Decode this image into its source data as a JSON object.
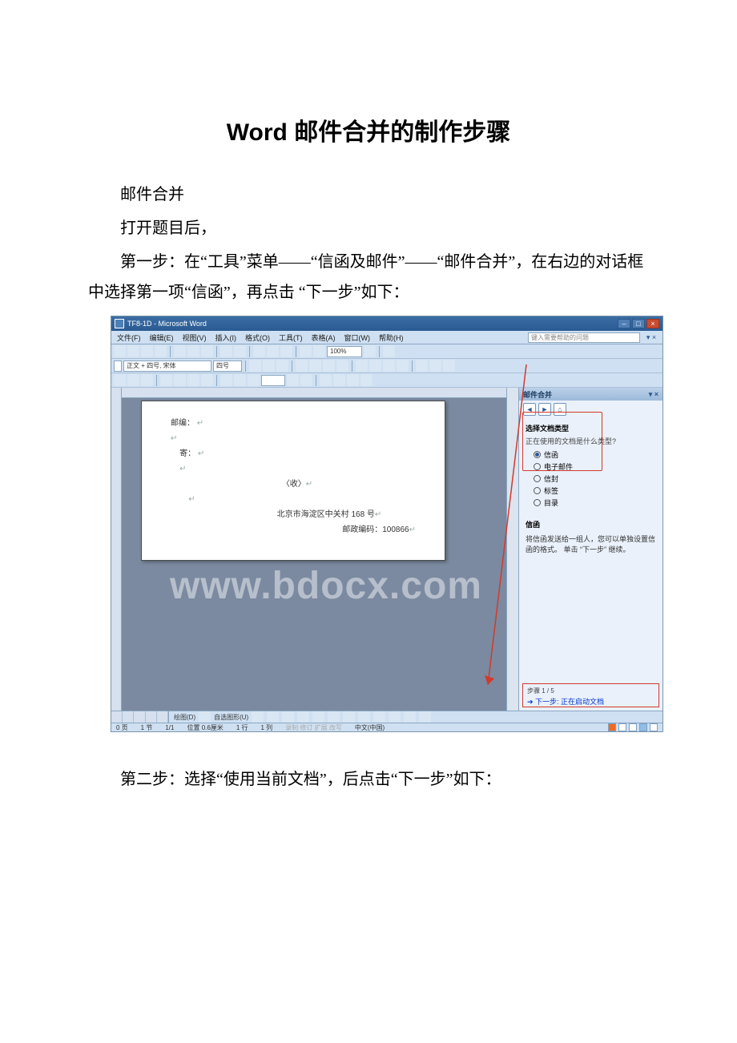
{
  "doc": {
    "title": "Word 邮件合并的制作步骤",
    "p1": "邮件合并",
    "p2": "打开题目后，",
    "p3": "第一步：在“工具”菜单——“信函及邮件”——“邮件合并”，在右边的对话框中选择第一项“信函”，再点击 “下一步”如下：",
    "p4": "第二步：选择“使用当前文档”，后点击“下一步”如下："
  },
  "word": {
    "title": "TF8-1D - Microsoft Word",
    "menus": [
      "文件(F)",
      "编辑(E)",
      "视图(V)",
      "插入(I)",
      "格式(O)",
      "工具(T)",
      "表格(A)",
      "窗口(W)",
      "帮助(H)"
    ],
    "help_placeholder": "键入需要帮助的问题",
    "style": "正文 + 四号, 宋体",
    "font_size": "四号",
    "zoom": "100%",
    "page_lines": {
      "l1": "邮编：",
      "l2": "寄：",
      "l3": "〈收〉",
      "l4": "北京市海淀区中关村 168 号",
      "l5": "邮政编码：100866"
    },
    "watermark": "www.bdocx.com",
    "drawbar": [
      "绘图(D)",
      "自选图形(U)"
    ],
    "status": {
      "page": "0 页",
      "section": "1 节",
      "pages": "1/1",
      "pos": "位置 0.6厘米",
      "line": "1 行",
      "col": "1 列",
      "mode": "录制  修订  扩展  改写",
      "lang": "中文(中国)"
    }
  },
  "pane": {
    "title": "邮件合并",
    "section1_title": "选择文档类型",
    "section1_sub": "正在使用的文档是什么类型?",
    "options": [
      "信函",
      "电子邮件",
      "信封",
      "标签",
      "目录"
    ],
    "selected": 0,
    "section2_title": "信函",
    "section2_desc": "将信函发送给一组人，您可以单独设置信函的格式。\n单击 “下一步” 继续。",
    "step_label": "步骤 1 / 5",
    "step_link": "下一步: 正在启动文档"
  }
}
